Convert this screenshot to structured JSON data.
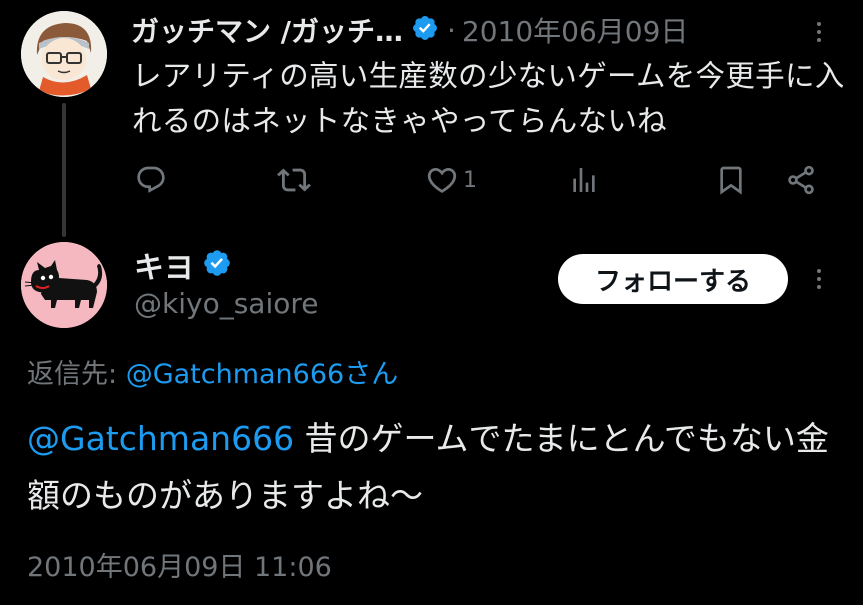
{
  "parent_tweet": {
    "display_name": "ガッチマン /ガッチ…",
    "separator": "·",
    "date": "2010年06月09日",
    "text": "レアリティの高い生産数の少ないゲームを今更手に入れるのはネットなきゃやってらんないね",
    "actions": {
      "reply_icon": "reply-icon",
      "retweet_icon": "retweet-icon",
      "like_icon": "heart-icon",
      "like_count": "1",
      "views_icon": "analytics-icon",
      "bookmark_icon": "bookmark-icon",
      "share_icon": "share-icon"
    }
  },
  "main_tweet": {
    "display_name": "キヨ",
    "handle": "@kiyo_saiore",
    "follow_label": "フォローする",
    "reply_to_prefix": "返信先: ",
    "reply_to_user": "@Gatchman666さん",
    "mention": "@Gatchman666",
    "text": " 昔のゲームでたまにとんでもない金額のものがありますよね〜",
    "timestamp": "2010年06月09日 11:06"
  },
  "colors": {
    "background": "#000000",
    "text_primary": "#e7e9ea",
    "text_secondary": "#71767b",
    "accent_blue": "#1d9bf0",
    "thread_line": "#333639",
    "follow_button_bg": "#ffffff"
  }
}
